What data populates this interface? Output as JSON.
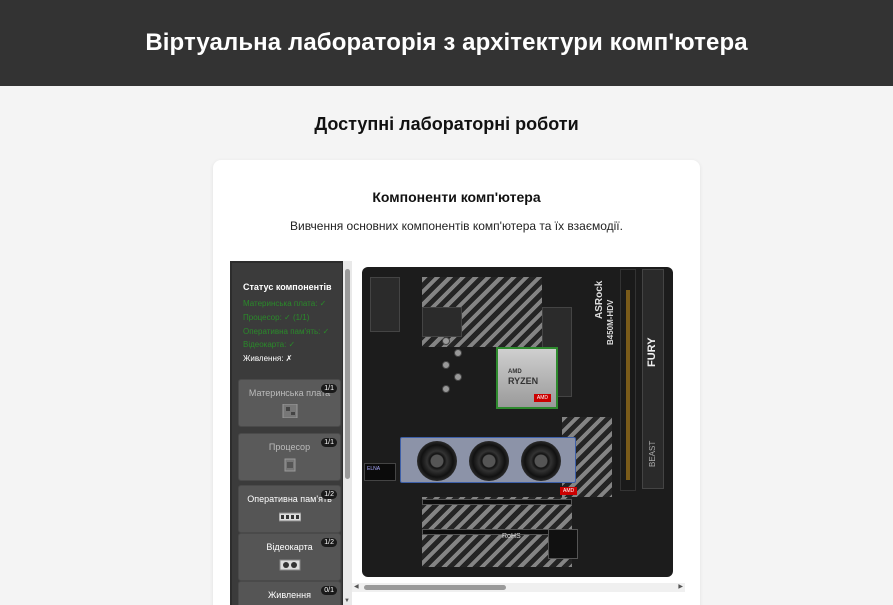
{
  "header": {
    "title": "Віртуальна лабораторія з архітектури комп'ютера"
  },
  "main": {
    "section_title": "Доступні лабораторні роботи"
  },
  "card": {
    "title": "Компоненти комп'ютера",
    "description": "Вивчення основних компонентів комп'ютера та їх взаємодії."
  },
  "lab": {
    "status": {
      "title": "Статус компонентів",
      "lines": [
        "Материнська плата: ✓",
        "Процесор: ✓ (1/1)",
        "Оперативна пам'ять: ✓",
        "Відеокарта: ✓"
      ],
      "power": "Живлення: ✗"
    },
    "components": [
      {
        "name": "Материнська плата",
        "badge": "1/1",
        "icon": "motherboard-icon"
      },
      {
        "name": "Процесор",
        "badge": "1/1",
        "icon": "cpu-icon"
      },
      {
        "name": "Оперативна пам'ять",
        "badge": "1/2",
        "icon": "ram-icon"
      },
      {
        "name": "Відеокарта",
        "badge": "1/2",
        "icon": "gpu-icon"
      },
      {
        "name": "Живлення",
        "badge": "0/1",
        "icon": "psu-icon"
      }
    ],
    "board": {
      "cpu_brand": "AMD",
      "cpu_model": "RYZEN",
      "cpu_tag": "AMD",
      "board_brand": "ASRock",
      "board_model": "B450M-HDV",
      "ram_brand": "FURY",
      "ram_series": "BEAST",
      "gpu_badge": "ELNA",
      "amd_label": "AMD",
      "rohs": "RoHS"
    }
  }
}
